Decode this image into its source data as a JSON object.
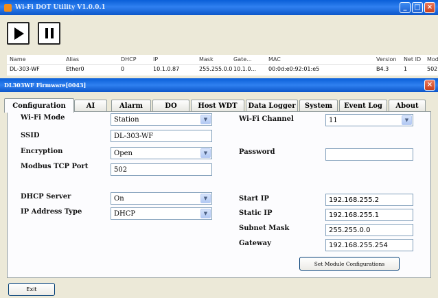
{
  "window": {
    "title": "Wi-Fi DOT Utility V1.0.0.1"
  },
  "toolbar": {
    "play_icon": "play-icon",
    "pause_icon": "pause-icon"
  },
  "grid": {
    "columns": [
      "Name",
      "Alias",
      "DHCP",
      "IP",
      "Mask",
      "Gate...",
      "MAC",
      "Version",
      "Net ID",
      "Mod"
    ],
    "row": [
      "DL-303-WF",
      "Ether0",
      "0",
      "10.1.0.87",
      "255.255.0.0",
      "10.1.0...",
      "00:0d:e0:92:01:e5",
      "B4.3",
      "1",
      "502"
    ]
  },
  "dialog": {
    "title": "DL303WF Firmware[0043]"
  },
  "tabs": [
    "Configuration",
    "AI",
    "Alarm",
    "DO",
    "Host WDT",
    "Data Logger",
    "System",
    "Event Log",
    "About"
  ],
  "config": {
    "wifi_mode_label": "Wi-Fi Mode",
    "wifi_mode_value": "Station",
    "ssid_label": "SSID",
    "ssid_value": "DL-303-WF",
    "encryption_label": "Encryption",
    "encryption_value": "Open",
    "modbus_port_label": "Modbus TCP Port",
    "modbus_port_value": "502",
    "dhcp_server_label": "DHCP Server",
    "dhcp_server_value": "On",
    "ip_type_label": "IP Address Type",
    "ip_type_value": "DHCP",
    "wifi_channel_label": "Wi-Fi Channel",
    "wifi_channel_value": "11",
    "password_label": "Password",
    "password_value": "",
    "start_ip_label": "Start IP",
    "start_ip_value": "192.168.255.2",
    "static_ip_label": "Static IP",
    "static_ip_value": "192.168.255.1",
    "subnet_mask_label": "Subnet Mask",
    "subnet_mask_value": "255.255.0.0",
    "gateway_label": "Gateway",
    "gateway_value": "192.168.255.254",
    "set_button": "Set Module Configurations"
  },
  "footer": {
    "exit_label": "Exit"
  }
}
